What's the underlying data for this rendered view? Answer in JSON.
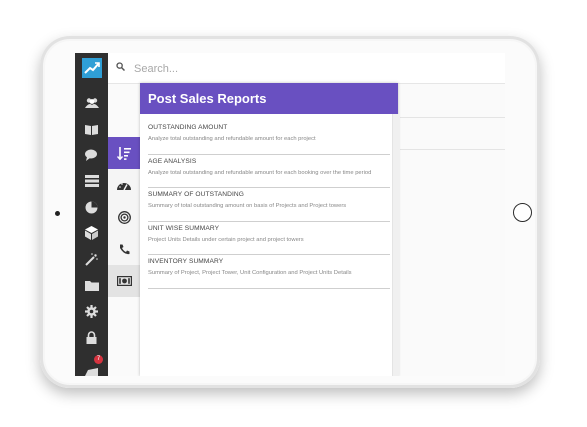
{
  "search": {
    "placeholder": "Search..."
  },
  "sidebar": {
    "items": [
      {
        "icon": "users-icon"
      },
      {
        "icon": "book-icon"
      },
      {
        "icon": "chat-icon"
      },
      {
        "icon": "list-icon"
      },
      {
        "icon": "pie-chart-icon"
      },
      {
        "icon": "cube-icon"
      },
      {
        "icon": "magic-wand-icon"
      },
      {
        "icon": "folder-icon"
      },
      {
        "icon": "gear-icon"
      },
      {
        "icon": "lock-icon"
      },
      {
        "icon": "notification-icon",
        "badge": "7"
      }
    ]
  },
  "subnav": {
    "items": [
      {
        "icon": "sort-icon",
        "active": true
      },
      {
        "icon": "dashboard-icon"
      },
      {
        "icon": "target-icon"
      },
      {
        "icon": "phone-icon"
      },
      {
        "icon": "money-icon"
      }
    ]
  },
  "panel": {
    "title": "Post Sales Reports",
    "reports": [
      {
        "title": "OUTSTANDING AMOUNT",
        "description": "Analyze total outstanding and refundable amount for each project"
      },
      {
        "title": "AGE ANALYSIS",
        "description": "Analyze total outstanding and refundable amount for each booking over the time period"
      },
      {
        "title": "SUMMARY OF OUTSTANDING",
        "description": "Summary of total outstanding amount on basis of Projects and Project towers"
      },
      {
        "title": "UNIT WISE SUMMARY",
        "description": "Project Units Details under certain project and project towers"
      },
      {
        "title": "INVENTORY SUMMARY",
        "description": "Summary of Project, Project Tower, Unit Configuration and Project Units Details"
      }
    ]
  },
  "colors": {
    "accent": "#6950c1",
    "sidebar": "#2f2f2f",
    "logo": "#2f9fd6",
    "badge": "#d6333f"
  }
}
